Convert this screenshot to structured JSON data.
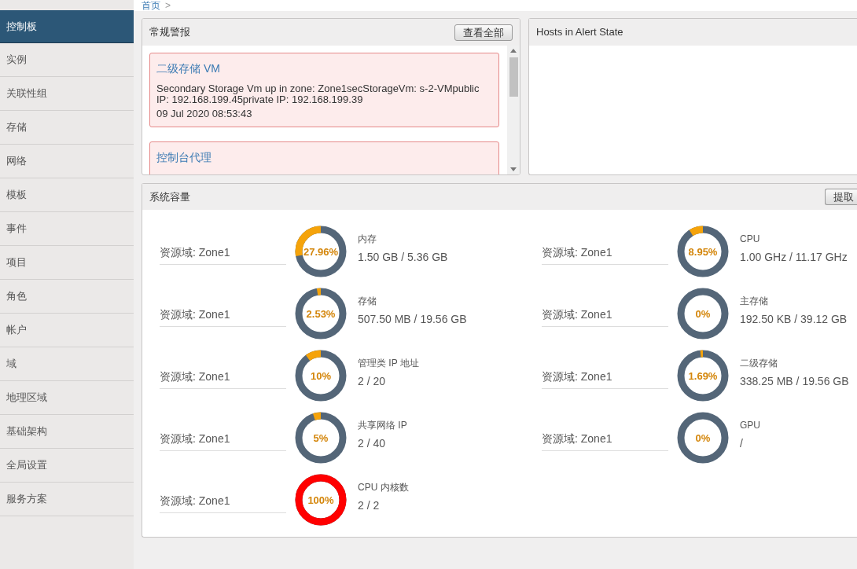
{
  "sidebar": {
    "items": [
      {
        "label": "控制板",
        "selected": true
      },
      {
        "label": "实例",
        "selected": false
      },
      {
        "label": "关联性组",
        "selected": false
      },
      {
        "label": "存储",
        "selected": false
      },
      {
        "label": "网络",
        "selected": false
      },
      {
        "label": "模板",
        "selected": false
      },
      {
        "label": "事件",
        "selected": false
      },
      {
        "label": "项目",
        "selected": false
      },
      {
        "label": "角色",
        "selected": false
      },
      {
        "label": "帐户",
        "selected": false
      },
      {
        "label": "域",
        "selected": false
      },
      {
        "label": "地理区域",
        "selected": false
      },
      {
        "label": "基础架构",
        "selected": false
      },
      {
        "label": "全局设置",
        "selected": false
      },
      {
        "label": "服务方案",
        "selected": false
      }
    ]
  },
  "breadcrumb": {
    "home": "首页",
    "separator": ">"
  },
  "alerts_panel": {
    "title": "常规警报",
    "button": "查看全部",
    "alerts": [
      {
        "title": "二级存储 VM",
        "message": "Secondary Storage Vm up in zone: Zone1secStorageVm: s-2-VMpublic IP: 192.168.199.45private IP: 192.168.199.39",
        "time": "09 Jul 2020 08:53:43"
      },
      {
        "title": "控制台代理"
      }
    ]
  },
  "hosts_panel": {
    "title": "Hosts in Alert State"
  },
  "capacity_panel": {
    "title": "系统容量",
    "button": "提取",
    "items": [
      {
        "zone": "资源域: Zone1",
        "name": "内存",
        "usage": "1.50 GB / 5.36 GB",
        "percent": "27.96%",
        "level": 0.2796
      },
      {
        "zone": "资源域: Zone1",
        "name": "CPU",
        "usage": "1.00 GHz / 11.17 GHz",
        "percent": "8.95%",
        "level": 0.0895
      },
      {
        "zone": "资源域: Zone1",
        "name": "存储",
        "usage": "507.50 MB / 19.56 GB",
        "percent": "2.53%",
        "level": 0.0253
      },
      {
        "zone": "资源域: Zone1",
        "name": "主存储",
        "usage": "192.50 KB / 39.12 GB",
        "percent": "0%",
        "level": 0
      },
      {
        "zone": "资源域: Zone1",
        "name": "管理类 IP 地址",
        "usage": "2 / 20",
        "percent": "10%",
        "level": 0.1
      },
      {
        "zone": "资源域: Zone1",
        "name": "二级存储",
        "usage": "338.25 MB / 19.56 GB",
        "percent": "1.69%",
        "level": 0.0169
      },
      {
        "zone": "资源域: Zone1",
        "name": "共享网络 IP",
        "usage": "2 / 40",
        "percent": "5%",
        "level": 0.05
      },
      {
        "zone": "资源域: Zone1",
        "name": "GPU",
        "usage": "/",
        "percent": "0%",
        "level": 0
      },
      {
        "zone": "资源域: Zone1",
        "name": "CPU 内核数",
        "usage": "2 / 2",
        "percent": "100%",
        "level": 1
      }
    ]
  }
}
